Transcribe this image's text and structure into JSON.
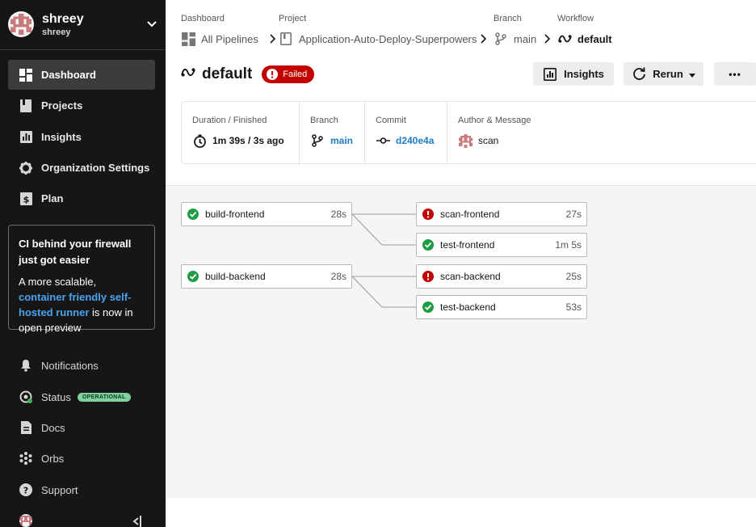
{
  "org": {
    "name": "shreey",
    "subtitle": "shreey"
  },
  "sidebar": {
    "nav": [
      {
        "label": "Dashboard",
        "icon": "dashboard-icon",
        "active": true
      },
      {
        "label": "Projects",
        "icon": "book-icon"
      },
      {
        "label": "Insights",
        "icon": "chart-icon"
      },
      {
        "label": "Organization Settings",
        "icon": "gear-icon"
      },
      {
        "label": "Plan",
        "icon": "dollar-icon"
      }
    ],
    "promo": {
      "title": "CI behind your firewall just got easier",
      "body_prefix": "A more scalable, ",
      "link": "container friendly self-hosted runner",
      "body_suffix": " is now in open preview"
    },
    "bottom": [
      {
        "label": "Notifications",
        "icon": "bell-icon"
      },
      {
        "label": "Status",
        "icon": "status-icon",
        "badge": "OPERATIONAL"
      },
      {
        "label": "Docs",
        "icon": "doc-icon"
      },
      {
        "label": "Orbs",
        "icon": "orbs-icon"
      },
      {
        "label": "Support",
        "icon": "help-icon"
      }
    ]
  },
  "breadcrumb": {
    "dashboard_label": "Dashboard",
    "dashboard_value": "All Pipelines",
    "project_label": "Project",
    "project_value": "Application-Auto-Deploy-Superpowers",
    "branch_label": "Branch",
    "branch_value": "main",
    "workflow_label": "Workflow",
    "workflow_value": "default"
  },
  "header": {
    "title": "default",
    "status": "Failed",
    "insights_label": "Insights",
    "rerun_label": "Rerun",
    "more_label": "•••"
  },
  "meta": {
    "duration_label": "Duration / Finished",
    "duration_value": "1m 39s / 3s ago",
    "branch_label": "Branch",
    "branch_value": "main",
    "commit_label": "Commit",
    "commit_value": "d240e4a",
    "author_label": "Author & Message",
    "author_value": "scan"
  },
  "jobs": [
    {
      "name": "build-frontend",
      "time": "28s",
      "status": "success"
    },
    {
      "name": "build-backend",
      "time": "28s",
      "status": "success"
    },
    {
      "name": "scan-frontend",
      "time": "27s",
      "status": "failed"
    },
    {
      "name": "test-frontend",
      "time": "1m 5s",
      "status": "success"
    },
    {
      "name": "scan-backend",
      "time": "25s",
      "status": "failed"
    },
    {
      "name": "test-backend",
      "time": "53s",
      "status": "success"
    }
  ],
  "colors": {
    "success": "#1f9d45",
    "failed": "#c20000",
    "link": "#1e7bc8",
    "sidebar": "#161616"
  }
}
